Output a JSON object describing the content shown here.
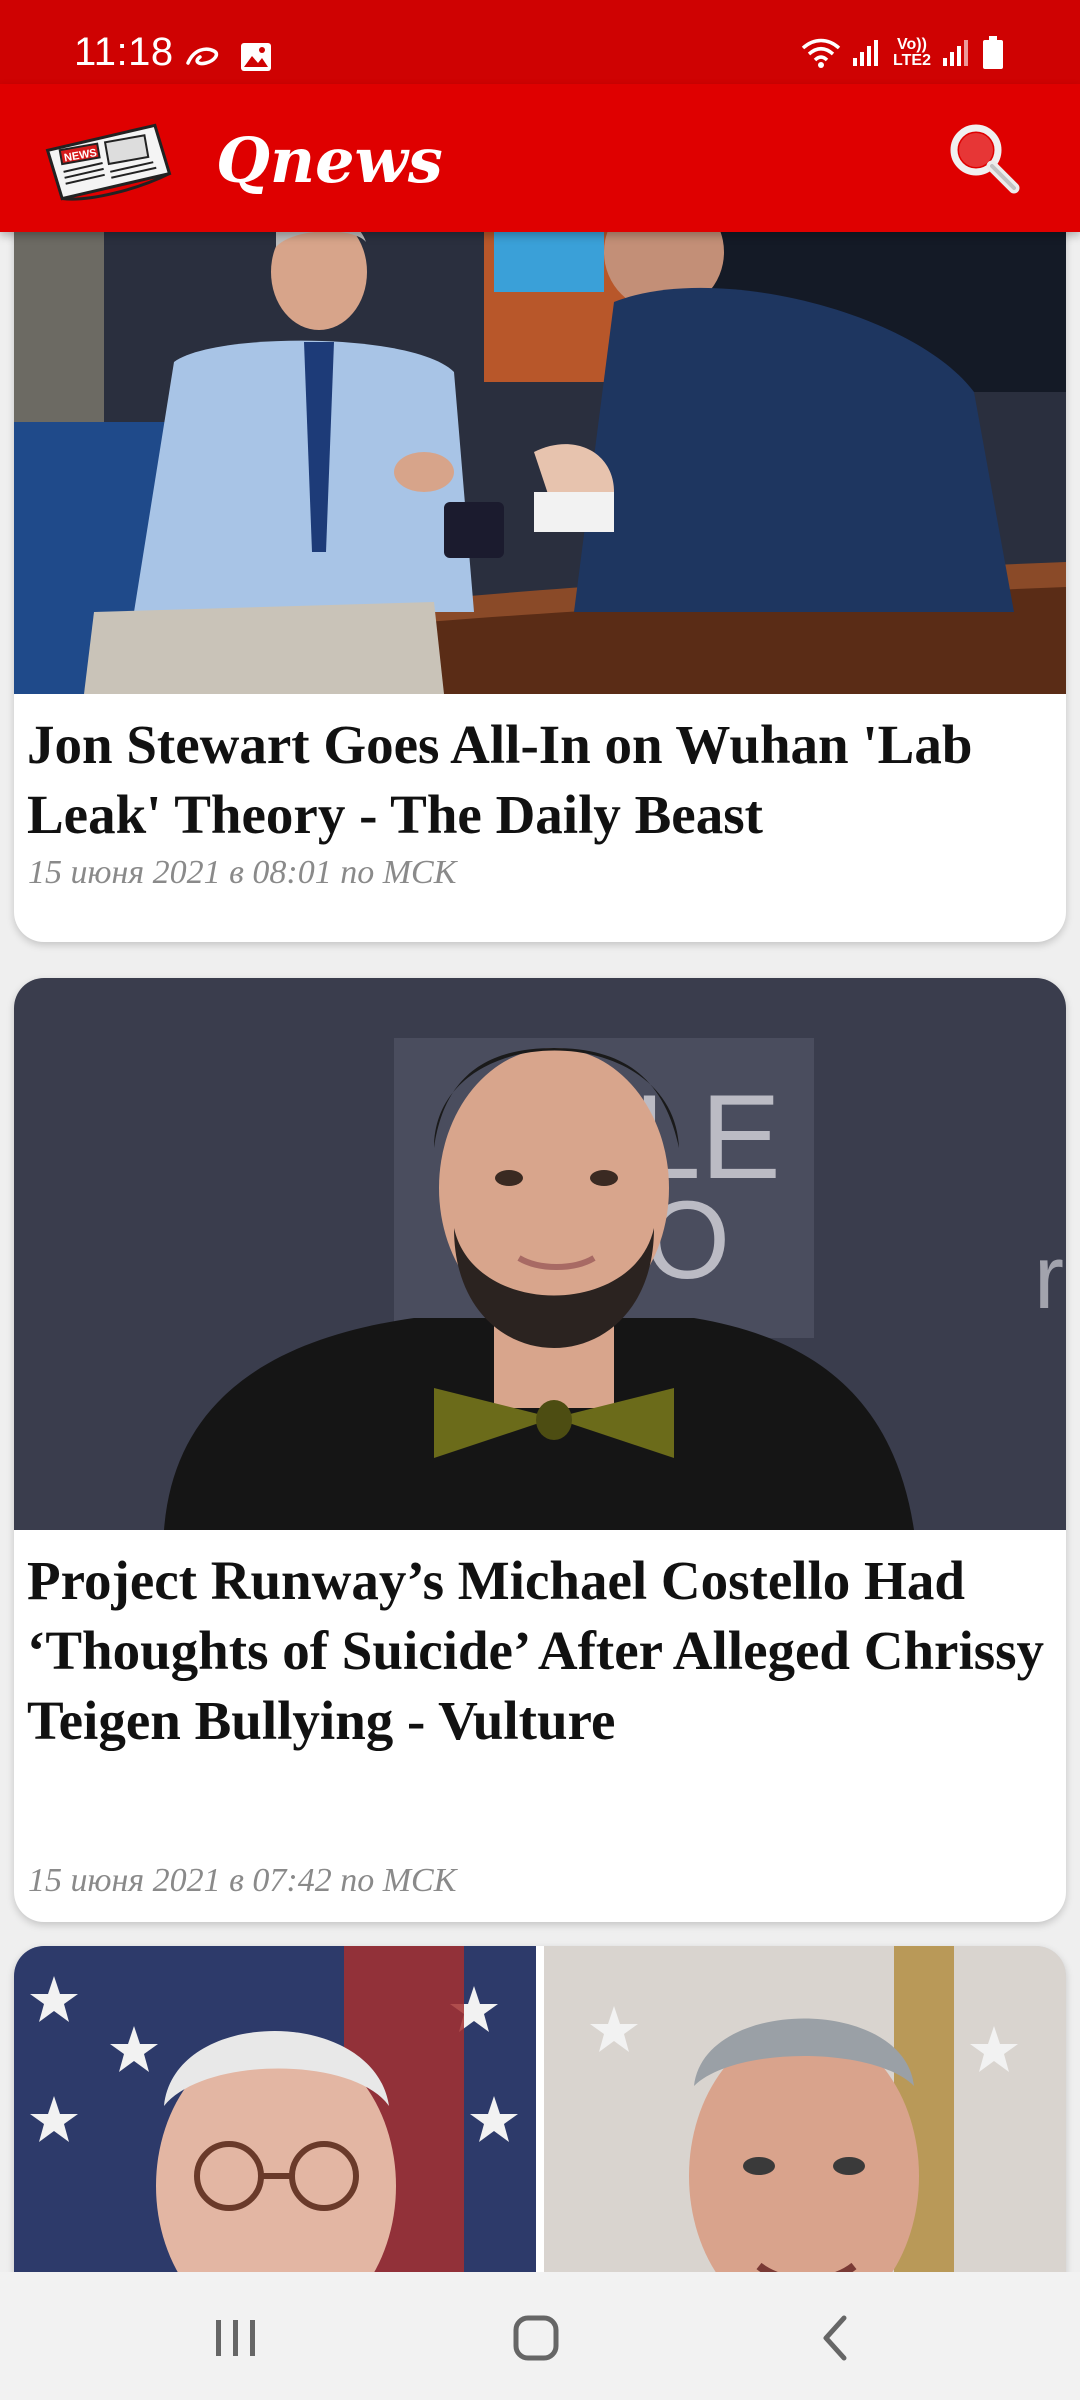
{
  "status_bar": {
    "time": "11:18",
    "left_icons": [
      "gesture-icon",
      "gallery-icon"
    ],
    "right_icons": [
      "wifi-icon",
      "signal-icon",
      "volte-icon",
      "signal-icon",
      "battery-icon"
    ],
    "volte_label": "Vo)) LTE2"
  },
  "app_bar": {
    "title": "Qnews",
    "logo_text": "NEWS",
    "search_icon": "search-icon"
  },
  "articles": [
    {
      "title": "Jon Stewart Goes All-In on Wuhan 'Lab Leak' Theory - The Daily Beast",
      "date": "15 июня 2021 в 08:01 по МСК"
    },
    {
      "title": "Project Runway’s Michael Costello Had ‘Thoughts of Suicide’ After Alleged Chrissy Teigen Bullying - Vulture",
      "date": "15 июня 2021 в 07:42 по МСК"
    },
    {
      "title": "",
      "date": ""
    }
  ],
  "nav_bar": {
    "buttons": [
      "recents-icon",
      "home-icon",
      "back-icon"
    ]
  },
  "colors": {
    "status_bar": "#cf0202",
    "app_bar": "#df0000",
    "background": "#efefef",
    "date_text": "#8a8a8a"
  }
}
